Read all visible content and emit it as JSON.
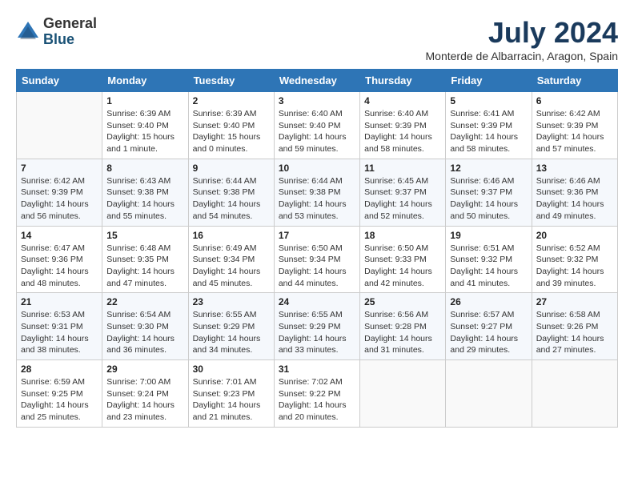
{
  "logo": {
    "general": "General",
    "blue": "Blue"
  },
  "title": "July 2024",
  "location": "Monterde de Albarracin, Aragon, Spain",
  "headers": [
    "Sunday",
    "Monday",
    "Tuesday",
    "Wednesday",
    "Thursday",
    "Friday",
    "Saturday"
  ],
  "weeks": [
    [
      {
        "day": "",
        "info": ""
      },
      {
        "day": "1",
        "info": "Sunrise: 6:39 AM\nSunset: 9:40 PM\nDaylight: 15 hours\nand 1 minute."
      },
      {
        "day": "2",
        "info": "Sunrise: 6:39 AM\nSunset: 9:40 PM\nDaylight: 15 hours\nand 0 minutes."
      },
      {
        "day": "3",
        "info": "Sunrise: 6:40 AM\nSunset: 9:40 PM\nDaylight: 14 hours\nand 59 minutes."
      },
      {
        "day": "4",
        "info": "Sunrise: 6:40 AM\nSunset: 9:39 PM\nDaylight: 14 hours\nand 58 minutes."
      },
      {
        "day": "5",
        "info": "Sunrise: 6:41 AM\nSunset: 9:39 PM\nDaylight: 14 hours\nand 58 minutes."
      },
      {
        "day": "6",
        "info": "Sunrise: 6:42 AM\nSunset: 9:39 PM\nDaylight: 14 hours\nand 57 minutes."
      }
    ],
    [
      {
        "day": "7",
        "info": "Sunrise: 6:42 AM\nSunset: 9:39 PM\nDaylight: 14 hours\nand 56 minutes."
      },
      {
        "day": "8",
        "info": "Sunrise: 6:43 AM\nSunset: 9:38 PM\nDaylight: 14 hours\nand 55 minutes."
      },
      {
        "day": "9",
        "info": "Sunrise: 6:44 AM\nSunset: 9:38 PM\nDaylight: 14 hours\nand 54 minutes."
      },
      {
        "day": "10",
        "info": "Sunrise: 6:44 AM\nSunset: 9:38 PM\nDaylight: 14 hours\nand 53 minutes."
      },
      {
        "day": "11",
        "info": "Sunrise: 6:45 AM\nSunset: 9:37 PM\nDaylight: 14 hours\nand 52 minutes."
      },
      {
        "day": "12",
        "info": "Sunrise: 6:46 AM\nSunset: 9:37 PM\nDaylight: 14 hours\nand 50 minutes."
      },
      {
        "day": "13",
        "info": "Sunrise: 6:46 AM\nSunset: 9:36 PM\nDaylight: 14 hours\nand 49 minutes."
      }
    ],
    [
      {
        "day": "14",
        "info": "Sunrise: 6:47 AM\nSunset: 9:36 PM\nDaylight: 14 hours\nand 48 minutes."
      },
      {
        "day": "15",
        "info": "Sunrise: 6:48 AM\nSunset: 9:35 PM\nDaylight: 14 hours\nand 47 minutes."
      },
      {
        "day": "16",
        "info": "Sunrise: 6:49 AM\nSunset: 9:34 PM\nDaylight: 14 hours\nand 45 minutes."
      },
      {
        "day": "17",
        "info": "Sunrise: 6:50 AM\nSunset: 9:34 PM\nDaylight: 14 hours\nand 44 minutes."
      },
      {
        "day": "18",
        "info": "Sunrise: 6:50 AM\nSunset: 9:33 PM\nDaylight: 14 hours\nand 42 minutes."
      },
      {
        "day": "19",
        "info": "Sunrise: 6:51 AM\nSunset: 9:32 PM\nDaylight: 14 hours\nand 41 minutes."
      },
      {
        "day": "20",
        "info": "Sunrise: 6:52 AM\nSunset: 9:32 PM\nDaylight: 14 hours\nand 39 minutes."
      }
    ],
    [
      {
        "day": "21",
        "info": "Sunrise: 6:53 AM\nSunset: 9:31 PM\nDaylight: 14 hours\nand 38 minutes."
      },
      {
        "day": "22",
        "info": "Sunrise: 6:54 AM\nSunset: 9:30 PM\nDaylight: 14 hours\nand 36 minutes."
      },
      {
        "day": "23",
        "info": "Sunrise: 6:55 AM\nSunset: 9:29 PM\nDaylight: 14 hours\nand 34 minutes."
      },
      {
        "day": "24",
        "info": "Sunrise: 6:55 AM\nSunset: 9:29 PM\nDaylight: 14 hours\nand 33 minutes."
      },
      {
        "day": "25",
        "info": "Sunrise: 6:56 AM\nSunset: 9:28 PM\nDaylight: 14 hours\nand 31 minutes."
      },
      {
        "day": "26",
        "info": "Sunrise: 6:57 AM\nSunset: 9:27 PM\nDaylight: 14 hours\nand 29 minutes."
      },
      {
        "day": "27",
        "info": "Sunrise: 6:58 AM\nSunset: 9:26 PM\nDaylight: 14 hours\nand 27 minutes."
      }
    ],
    [
      {
        "day": "28",
        "info": "Sunrise: 6:59 AM\nSunset: 9:25 PM\nDaylight: 14 hours\nand 25 minutes."
      },
      {
        "day": "29",
        "info": "Sunrise: 7:00 AM\nSunset: 9:24 PM\nDaylight: 14 hours\nand 23 minutes."
      },
      {
        "day": "30",
        "info": "Sunrise: 7:01 AM\nSunset: 9:23 PM\nDaylight: 14 hours\nand 21 minutes."
      },
      {
        "day": "31",
        "info": "Sunrise: 7:02 AM\nSunset: 9:22 PM\nDaylight: 14 hours\nand 20 minutes."
      },
      {
        "day": "",
        "info": ""
      },
      {
        "day": "",
        "info": ""
      },
      {
        "day": "",
        "info": ""
      }
    ]
  ]
}
